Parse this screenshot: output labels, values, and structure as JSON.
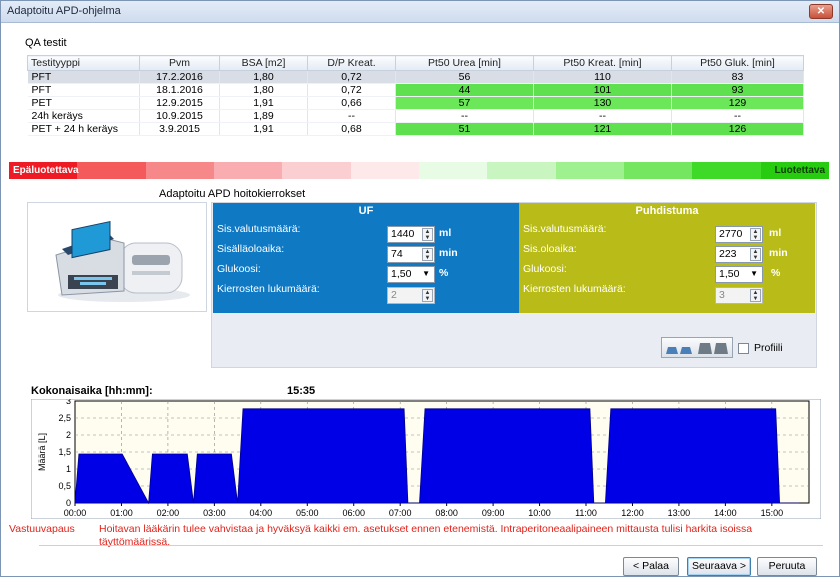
{
  "window": {
    "title": "Adaptoitu APD-ohjelma",
    "close_glyph": "✕"
  },
  "qa": {
    "section_label": "QA testit",
    "columns": [
      "Testityyppi",
      "Pvm",
      "BSA [m2]",
      "D/P Kreat.",
      "Pt50  Urea [min]",
      "Pt50 Kreat. [min]",
      "Pt50 Gluk. [min]"
    ],
    "rows": [
      {
        "type": "PFT",
        "date": "17.2.2016",
        "bsa": "1,80",
        "dp": "0,72",
        "urea": "56",
        "kreat": "110",
        "gluk": "83"
      },
      {
        "type": "PFT",
        "date": "18.1.2016",
        "bsa": "1,80",
        "dp": "0,72",
        "urea": "44",
        "kreat": "101",
        "gluk": "93"
      },
      {
        "type": "PET",
        "date": "12.9.2015",
        "bsa": "1,91",
        "dp": "0,66",
        "urea": "57",
        "kreat": "130",
        "gluk": "129"
      },
      {
        "type": "24h keräys",
        "date": "10.9.2015",
        "bsa": "1,89",
        "dp": "--",
        "urea": "--",
        "kreat": "--",
        "gluk": "--"
      },
      {
        "type": "PET + 24 h keräys",
        "date": "3.9.2015",
        "bsa": "1,91",
        "dp": "0,68",
        "urea": "51",
        "kreat": "121",
        "gluk": "126"
      }
    ]
  },
  "reliability": {
    "left_label": "Epäluotettava",
    "right_label": "Luotettava",
    "colors": [
      "#ee1b24",
      "#f4595c",
      "#f7888a",
      "#f9adb0",
      "#fbcfd1",
      "#fde9e9",
      "#e8fbe4",
      "#c9f6c0",
      "#9ff08f",
      "#74e65f",
      "#3fd927",
      "#27cc10"
    ]
  },
  "apd": {
    "section_label": "Adaptoitu APD hoitokierrokset",
    "uf": {
      "title": "UF",
      "fill_volume_label": "Sis.valutusmäärä:",
      "fill_volume": "1440",
      "fill_volume_unit": "ml",
      "dwell_label": "Sisälläoloaika:",
      "dwell": "74",
      "dwell_unit": "min",
      "glucose_label": "Glukoosi:",
      "glucose": "1,50",
      "glucose_unit": "%",
      "cycles_label": "Kierrosten lukumäärä:",
      "cycles": "2"
    },
    "cleaning": {
      "title": "Puhdistuma",
      "fill_volume_label": "Sis.valutusmäärä:",
      "fill_volume": "2770",
      "fill_volume_unit": "ml",
      "dwell_label": "Sis.oloaika:",
      "dwell": "223",
      "dwell_unit": "min",
      "glucose_label": "Glukoosi:",
      "glucose": "1,50",
      "glucose_unit": "%",
      "cycles_label": "Kierrosten lukumäärä:",
      "cycles": "3"
    },
    "profile_label": "Profiili",
    "uf_color": "#0f79c4",
    "cleaning_color": "#b9bc18"
  },
  "total_time": {
    "label": "Kokonaisaika [hh:mm]:",
    "value": "15:35"
  },
  "chart_data": {
    "type": "area",
    "ylabel": "Määrä [L]",
    "xlabel": "",
    "x": [
      "00:00",
      "00:05",
      "01:01",
      "01:35",
      "01:40",
      "02:25",
      "02:33",
      "02:38",
      "03:22",
      "03:30",
      "03:37",
      "07:05",
      "07:10",
      "07:25",
      "07:32",
      "11:05",
      "11:10",
      "11:25",
      "11:32",
      "15:05",
      "15:10",
      "15:35"
    ],
    "series": [
      {
        "values": [
          0,
          1.44,
          1.44,
          0,
          1.44,
          1.44,
          0,
          1.44,
          1.44,
          0,
          2.77,
          2.77,
          0,
          0,
          2.77,
          2.77,
          0,
          0,
          2.77,
          2.77,
          0,
          0
        ]
      }
    ],
    "x_ticks": [
      "00:00",
      "01:00",
      "02:00",
      "03:00",
      "04:00",
      "05:00",
      "06:00",
      "07:00",
      "08:00",
      "09:00",
      "10:00",
      "11:00",
      "12:00",
      "13:00",
      "14:00",
      "15:00"
    ],
    "y_ticks": [
      "0",
      "0,5",
      "1",
      "1,5",
      "2",
      "2,5",
      "3"
    ],
    "ylim": [
      0,
      3
    ],
    "xlim_hours": [
      0,
      15.8
    ],
    "grid": true,
    "fill_color": "#0000e6",
    "background": "#fffdf0"
  },
  "disclaimer": {
    "label": "Vastuuvapaus",
    "text": "Hoitavan lääkärin tulee vahvistaa ja hyväksyä kaikki em. asetukset ennen etenemistä. Intraperitoneaalipaineen mittausta tulisi harkita isoissa täyttömäärissä."
  },
  "buttons": {
    "back": "< Palaa",
    "next": "Seuraava >",
    "cancel": "Peruuta"
  }
}
